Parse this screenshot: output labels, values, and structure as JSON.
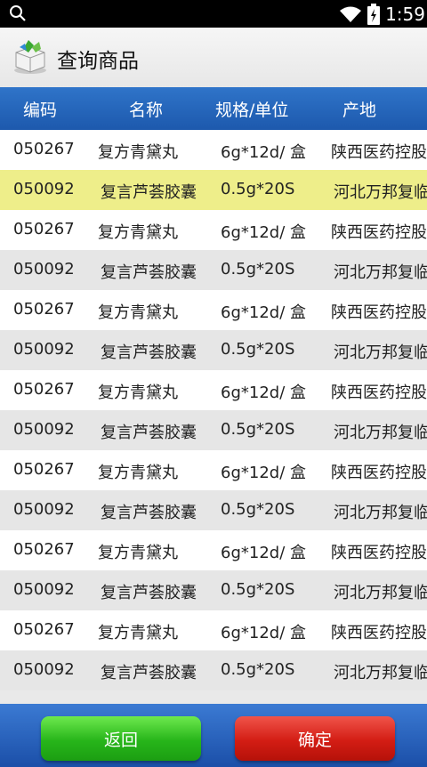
{
  "status_bar": {
    "time": "1:59"
  },
  "title_bar": {
    "title": "查询商品"
  },
  "table": {
    "headers": [
      "编码",
      "名称",
      "规格/单位",
      "产地"
    ],
    "rows": [
      {
        "code": "050267",
        "name": "复方青黛丸",
        "spec": "6g*12d/ 盒",
        "origin": "陕西医药控股"
      },
      {
        "code": "050092",
        "name": "复言芦荟胶囊",
        "spec": "0.5g*20S",
        "origin": "河北万邦复临"
      },
      {
        "code": "050267",
        "name": "复方青黛丸",
        "spec": "6g*12d/ 盒",
        "origin": "陕西医药控股"
      },
      {
        "code": "050092",
        "name": "复言芦荟胶囊",
        "spec": "0.5g*20S",
        "origin": "河北万邦复临"
      },
      {
        "code": "050267",
        "name": "复方青黛丸",
        "spec": "6g*12d/ 盒",
        "origin": "陕西医药控股"
      },
      {
        "code": "050092",
        "name": "复言芦荟胶囊",
        "spec": "0.5g*20S",
        "origin": "河北万邦复临"
      },
      {
        "code": "050267",
        "name": "复方青黛丸",
        "spec": "6g*12d/ 盒",
        "origin": "陕西医药控股"
      },
      {
        "code": "050092",
        "name": "复言芦荟胶囊",
        "spec": "0.5g*20S",
        "origin": "河北万邦复临"
      },
      {
        "code": "050267",
        "name": "复方青黛丸",
        "spec": "6g*12d/ 盒",
        "origin": "陕西医药控股"
      },
      {
        "code": "050092",
        "name": "复言芦荟胶囊",
        "spec": "0.5g*20S",
        "origin": "河北万邦复临"
      },
      {
        "code": "050267",
        "name": "复方青黛丸",
        "spec": "6g*12d/ 盒",
        "origin": "陕西医药控股"
      },
      {
        "code": "050092",
        "name": "复言芦荟胶囊",
        "spec": "0.5g*20S",
        "origin": "河北万邦复临"
      },
      {
        "code": "050267",
        "name": "复方青黛丸",
        "spec": "6g*12d/ 盒",
        "origin": "陕西医药控股"
      },
      {
        "code": "050092",
        "name": "复言芦荟胶囊",
        "spec": "0.5g*20S",
        "origin": "河北万邦复临"
      }
    ],
    "selected_row": 1
  },
  "buttons": {
    "back_label": "返回",
    "ok_label": "确定"
  },
  "colors": {
    "header_blue": "#2a6ac0",
    "selected_row": "#eeee8a",
    "back_green": "#34c222",
    "ok_red": "#d9251b"
  }
}
